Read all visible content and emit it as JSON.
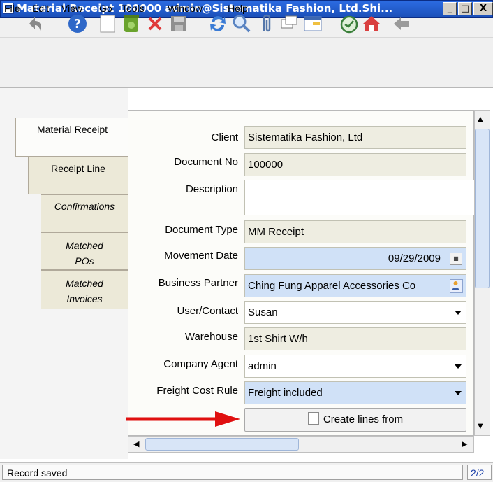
{
  "window": {
    "title": "Material Receipt  100000  admin@Sistematika Fashion, Ltd.Shi..."
  },
  "menu": [
    "File",
    "Edit",
    "View",
    "Go",
    "Tools",
    "Window",
    "Help"
  ],
  "toolbar": [
    "undo-icon",
    "help-icon",
    "new-record-icon",
    "copy-record-icon",
    "delete-icon",
    "save-icon",
    "refresh-icon",
    "find-icon",
    "attachment-icon",
    "chat-icon",
    "grid-toggle-icon",
    "history-icon",
    "home-icon",
    "back-icon"
  ],
  "tabs": {
    "receipt": "Material Receipt",
    "line": "Receipt Line",
    "confirmations": "Confirmations",
    "pos": "Matched POs",
    "invoices": "Matched Invoices"
  },
  "form": {
    "client_label": "Client",
    "client_value": "Sistematika Fashion, Ltd",
    "docno_label": "Document No",
    "docno_value": "100000",
    "description_label": "Description",
    "description_value": "",
    "doctype_label": "Document Type",
    "doctype_value": "MM Receipt",
    "movdate_label": "Movement Date",
    "movdate_value": "09/29/2009",
    "bpartner_label": "Business Partner",
    "bpartner_value": "Ching Fung Apparel Accessories Co",
    "user_label": "User/Contact",
    "user_value": "Susan",
    "warehouse_label": "Warehouse",
    "warehouse_value": "1st Shirt W/h",
    "agent_label": "Company Agent",
    "agent_value": "admin",
    "freight_label": "Freight Cost Rule",
    "freight_value": "Freight included",
    "create_lines_label": "Create lines from"
  },
  "status": {
    "message": "Record saved",
    "count": "2/2"
  },
  "colors": {
    "annotation_arrow": "#e01010",
    "mandatory_field": "#d0e1f7",
    "readonly_field": "#eeede1"
  }
}
